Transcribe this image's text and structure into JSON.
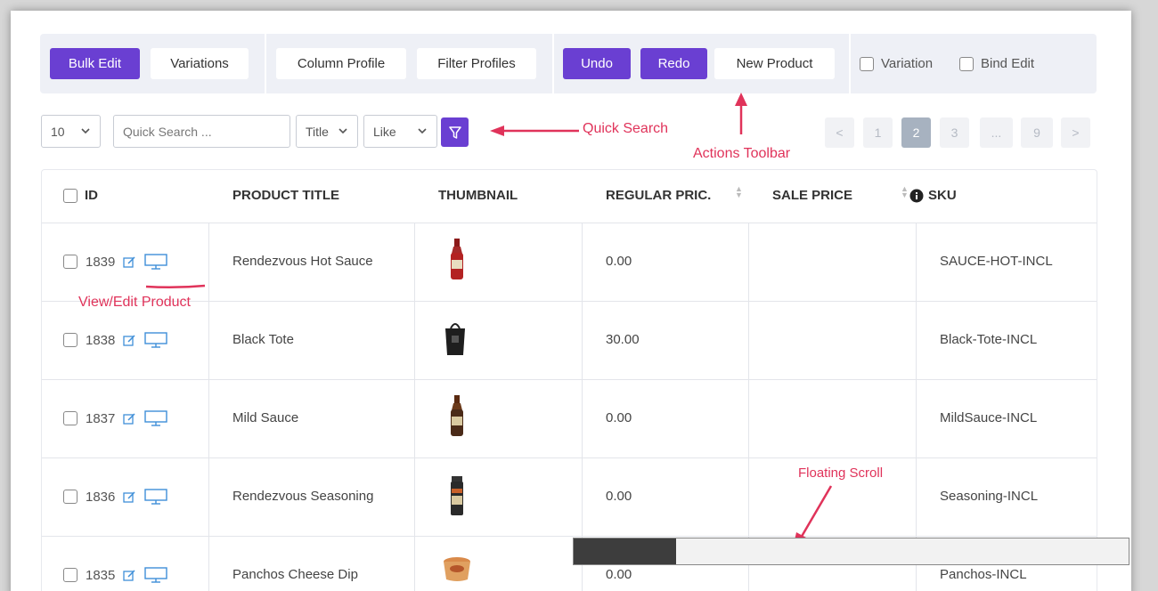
{
  "toolbar": {
    "bulk_edit": "Bulk Edit",
    "variations": "Variations",
    "column_profile": "Column Profile",
    "filter_profiles": "Filter Profiles",
    "undo": "Undo",
    "redo": "Redo",
    "new_product": "New Product",
    "variation_label": "Variation",
    "bind_edit_label": "Bind Edit"
  },
  "search": {
    "page_size": "10",
    "placeholder": "Quick Search ...",
    "field": "Title",
    "operator": "Like"
  },
  "pagination": {
    "prev": "<",
    "pages": [
      "1",
      "2",
      "3",
      "...",
      "9"
    ],
    "next": ">",
    "current_page": "2"
  },
  "annotations": {
    "quick_search": "Quick Search",
    "actions_toolbar": "Actions Toolbar",
    "view_edit_product": "View/Edit Product",
    "floating_scroll": "Floating Scroll"
  },
  "table": {
    "columns": {
      "id": "ID",
      "title": "PRODUCT TITLE",
      "thumbnail": "THUMBNAIL",
      "regular_price": "REGULAR PRIC.",
      "sale_price": "SALE PRICE",
      "sku": "SKU"
    },
    "rows": [
      {
        "id": "1839",
        "title": "Rendezvous Hot Sauce",
        "regular_price": "0.00",
        "sale_price": "",
        "sku": "SAUCE-HOT-INCL",
        "thumb": "hot-sauce-bottle-icon"
      },
      {
        "id": "1838",
        "title": "Black Tote",
        "regular_price": "30.00",
        "sale_price": "",
        "sku": "Black-Tote-INCL",
        "thumb": "tote-bag-icon"
      },
      {
        "id": "1837",
        "title": "Mild Sauce",
        "regular_price": "0.00",
        "sale_price": "",
        "sku": "MildSauce-INCL",
        "thumb": "sauce-bottle-icon"
      },
      {
        "id": "1836",
        "title": "Rendezvous Seasoning",
        "regular_price": "0.00",
        "sale_price": "",
        "sku": "Seasoning-INCL",
        "thumb": "seasoning-jar-icon"
      },
      {
        "id": "1835",
        "title": "Panchos Cheese Dip",
        "regular_price": "0.00",
        "sale_price": "",
        "sku": "Panchos-INCL",
        "thumb": "cheese-dip-tub-icon"
      }
    ]
  },
  "floating_scroll": {
    "position": 0.18
  },
  "colors": {
    "primary": "#6a3fd2",
    "annotation": "#e0335a",
    "action_icon": "#3f8fd8"
  }
}
